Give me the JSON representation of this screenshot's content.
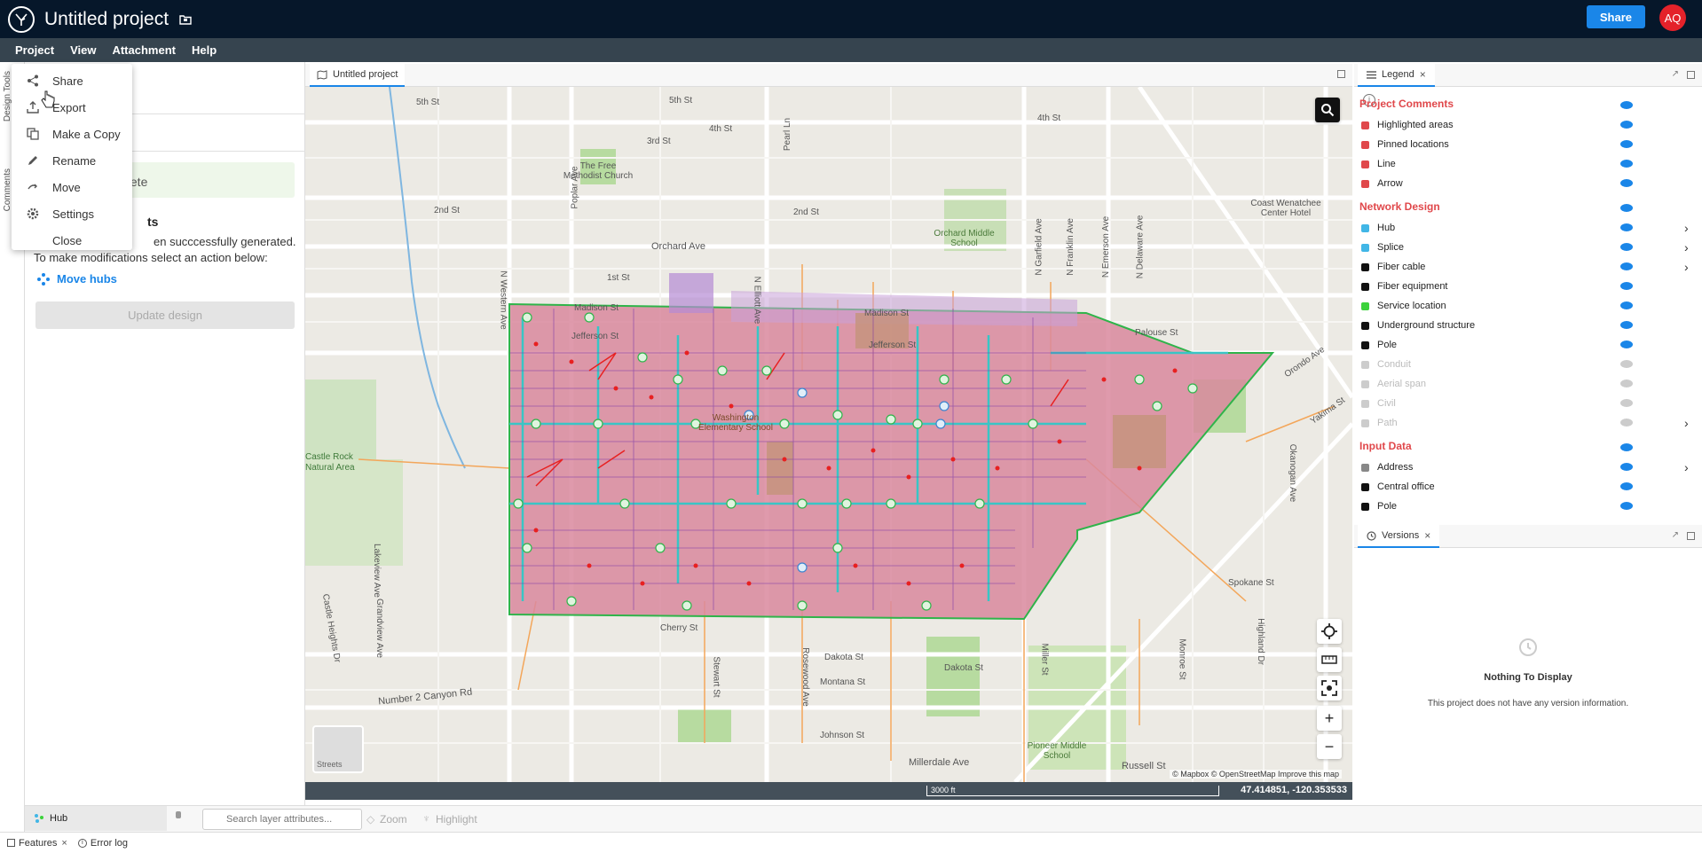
{
  "header": {
    "title": "Untitled project",
    "share_label": "Share",
    "avatar_initials": "AQ"
  },
  "menubar": {
    "items": [
      "Project",
      "View",
      "Attachment",
      "Help"
    ]
  },
  "dropdown": {
    "items": [
      "Share",
      "Export",
      "Make a Copy",
      "Rename",
      "Move",
      "Settings",
      "Close"
    ]
  },
  "left_strip": {
    "tabs": [
      "Design Tools",
      "Comments"
    ]
  },
  "left_panel": {
    "complete_text": "plete",
    "generated_title": "ts",
    "generated_desc": "en succcessfully generated. To make modifications select an action below:",
    "move_hubs": "Move hubs",
    "update_design": "Update design"
  },
  "map": {
    "tab_label": "Untitled project",
    "scale": "3000 ft",
    "coords": "47.414851, -120.353533",
    "attribution": "© Mapbox © OpenStreetMap  Improve this map",
    "basemap_label": "Streets",
    "labels": [
      "5th St",
      "5th St",
      "4th St",
      "4th St",
      "3rd St",
      "2nd St",
      "2nd St",
      "Orchard Ave",
      "1st St",
      "Madison St",
      "Madison St",
      "Jefferson St",
      "Jefferson St",
      "The Free Methodist Church",
      "Orchard Middle School",
      "Coast Wenatchee Center Hotel",
      "Washington Elementary School",
      "Dakota St",
      "Dakota St",
      "Montana St",
      "Johnson St",
      "Millerdale Ave",
      "Russell St",
      "Spokane St",
      "Number 2 Canyon Rd",
      "Pioneer Middle School",
      "Castle Rock Natural Area",
      "Palouse St",
      "Orondo Ave",
      "Yakima St",
      "Okanogan Ave",
      "N Western Ave",
      "N Elliott Ave",
      "Miller St",
      "Cherry St",
      "Castle Heights Dr",
      "Grandview Ave",
      "Lakeview Ave",
      "Stewart St",
      "Rosewood Ave",
      "Highland Dr",
      "Monroe St",
      "N Garfield Ave",
      "N Franklin Ave",
      "N Emerson Ave",
      "N Delaware Ave",
      "Poplar Ave",
      "Pearl Ln"
    ]
  },
  "legend": {
    "tab_label": "Legend",
    "sections": [
      {
        "title": "Project Comments",
        "items": [
          {
            "label": "Highlighted areas",
            "color": "#e0484b",
            "enabled": true
          },
          {
            "label": "Pinned locations",
            "color": "#e0484b",
            "enabled": true
          },
          {
            "label": "Line",
            "color": "#e0484b",
            "enabled": true
          },
          {
            "label": "Arrow",
            "color": "#e0484b",
            "enabled": true
          }
        ]
      },
      {
        "title": "Network Design",
        "items": [
          {
            "label": "Hub",
            "color": "#41b6e6",
            "enabled": true,
            "expandable": true
          },
          {
            "label": "Splice",
            "color": "#41b6e6",
            "enabled": true,
            "expandable": true
          },
          {
            "label": "Fiber cable",
            "color": "#111111",
            "enabled": true,
            "expandable": true
          },
          {
            "label": "Fiber equipment",
            "color": "#111111",
            "enabled": true
          },
          {
            "label": "Service location",
            "color": "#3cd23c",
            "enabled": true
          },
          {
            "label": "Underground structure",
            "color": "#111111",
            "enabled": true
          },
          {
            "label": "Pole",
            "color": "#111111",
            "enabled": true
          },
          {
            "label": "Conduit",
            "color": "#111111",
            "enabled": false
          },
          {
            "label": "Aerial span",
            "color": "#39c5c5",
            "enabled": false
          },
          {
            "label": "Civil",
            "color": "#f0a050",
            "enabled": false
          },
          {
            "label": "Path",
            "color": "#111111",
            "enabled": false,
            "expandable": true
          }
        ]
      },
      {
        "title": "Input Data",
        "items": [
          {
            "label": "Address",
            "color": "#888888",
            "enabled": true,
            "expandable": true
          },
          {
            "label": "Central office",
            "color": "#111111",
            "enabled": true
          },
          {
            "label": "Pole",
            "color": "#111111",
            "enabled": true
          }
        ]
      }
    ]
  },
  "versions": {
    "tab_label": "Versions",
    "empty_title": "Nothing To Display",
    "empty_desc": "This project does not have any version information."
  },
  "bottom": {
    "hub_chip": "Hub",
    "search_placeholder": "Search layer attributes...",
    "zoom": "Zoom",
    "highlight": "Highlight"
  },
  "footer": {
    "tabs": [
      "Features",
      "Error log"
    ]
  },
  "colors": {
    "accent": "#1a86e8",
    "header_bg": "#06172a",
    "menubar_bg": "#36444f",
    "section_red": "#e0484b",
    "avatar": "#e4222a"
  }
}
